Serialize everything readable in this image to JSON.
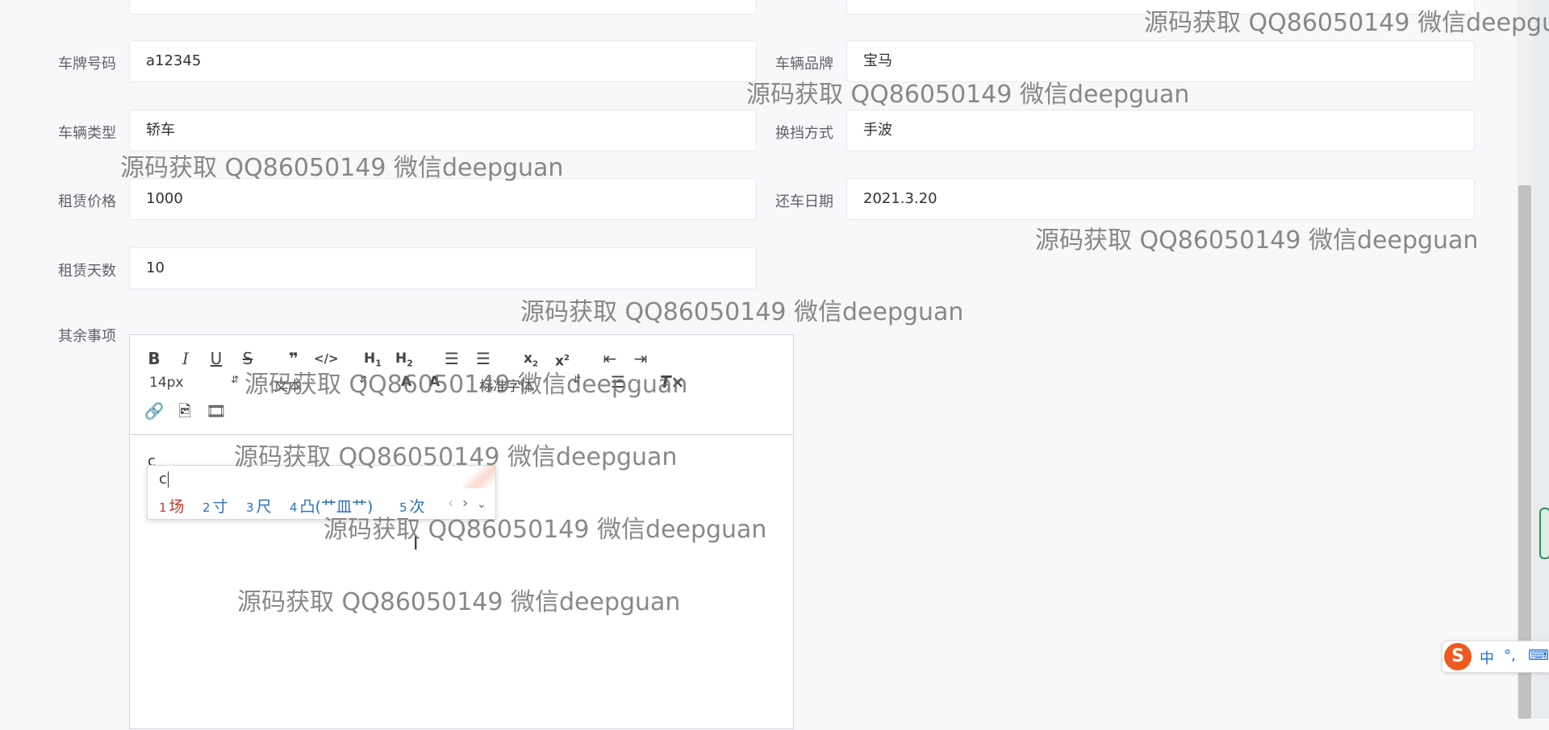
{
  "form": {
    "plate_label": "车牌号码",
    "plate_value": "a12345",
    "brand_label": "车辆品牌",
    "brand_value": "宝马",
    "type_label": "车辆类型",
    "type_value": "轿车",
    "gear_label": "换挡方式",
    "gear_value": "手波",
    "price_label": "租赁价格",
    "price_value": "1000",
    "return_label": "还车日期",
    "return_value": "2021.3.20",
    "days_label": "租赁天数",
    "days_value": "10",
    "notes_label": "其余事项"
  },
  "editor": {
    "toolbar": {
      "font_size": "14px",
      "font_text": "文本",
      "line_height": "标准字体"
    },
    "content": "c"
  },
  "ime": {
    "input": "c",
    "candidates": [
      {
        "num": "1",
        "text": "场"
      },
      {
        "num": "2",
        "text": "寸"
      },
      {
        "num": "3",
        "text": "尺"
      },
      {
        "num": "4",
        "text": "凸(艹皿艹)"
      },
      {
        "num": "5",
        "text": "次"
      }
    ],
    "bar": {
      "logo": "S",
      "lang": "中",
      "punct": "°,"
    }
  },
  "watermark": "源码获取 QQ86050149 微信deepguan",
  "watermark_cut": "源码获取 QQ86050149 微信deepgu",
  "colors": {
    "ime_logo": "#f05a1e",
    "ime_candidate": "#2a6ebb"
  }
}
